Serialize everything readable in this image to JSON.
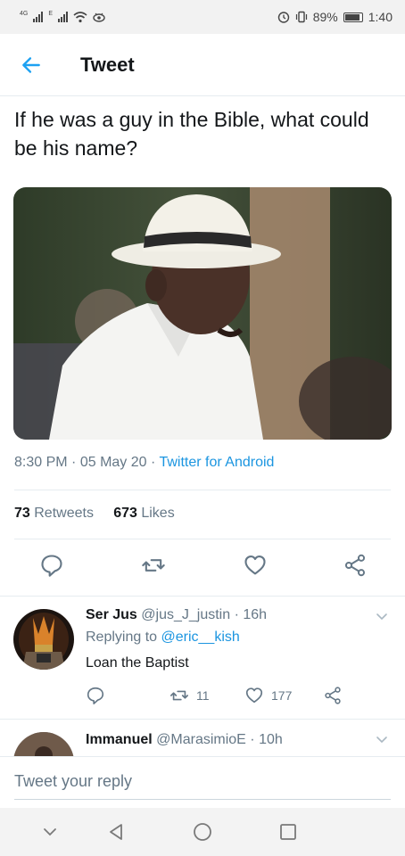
{
  "status_bar": {
    "left_network_1": "4G",
    "left_network_2": "E",
    "battery_percent": "89%",
    "time": "1:40"
  },
  "header": {
    "title": "Tweet"
  },
  "tweet": {
    "text": "If he was a guy in the Bible, what could be his name?",
    "time": "8:30 PM",
    "date": "05 May 20",
    "client": "Twitter for Android",
    "sep": "·",
    "retweets_count": "73",
    "retweets_label": "Retweets",
    "likes_count": "673",
    "likes_label": "Likes"
  },
  "icons": {
    "back": "arrow-left-icon",
    "reply": "reply-icon",
    "retweet": "retweet-icon",
    "like": "heart-icon",
    "share": "share-icon",
    "more": "chevron-down-icon"
  },
  "replies": [
    {
      "name": "Ser Jus",
      "handle": "@jus_J_justin",
      "time": "16h",
      "replying_to_label": "Replying to",
      "replying_to_handle": "@eric__kish",
      "text": "Loan the Baptist",
      "retweets": "11",
      "likes": "177"
    },
    {
      "name": "Immanuel",
      "handle": "@MarasimioE",
      "time": "10h"
    }
  ],
  "compose": {
    "placeholder": "Tweet your reply"
  },
  "colors": {
    "accent": "#1da1f2",
    "link": "#1b95e0",
    "muted": "#657786",
    "text": "#14171a"
  }
}
